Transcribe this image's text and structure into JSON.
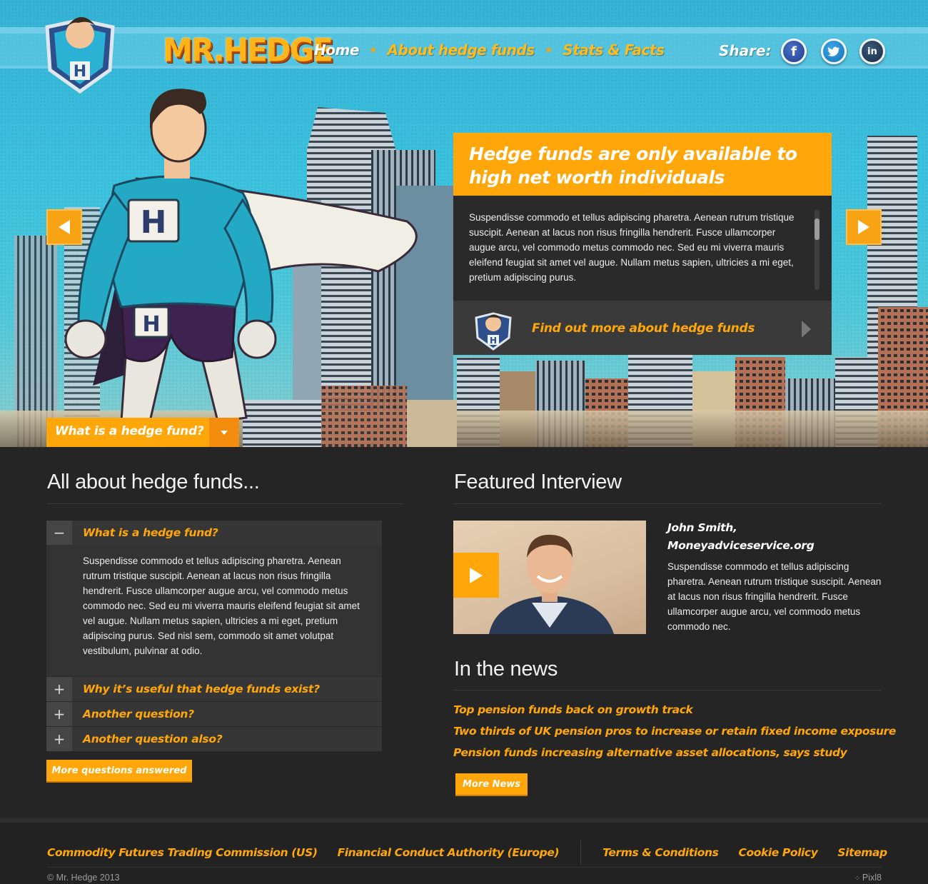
{
  "brand": {
    "name": "MR.HEDGE"
  },
  "nav": {
    "items": [
      {
        "label": "Home"
      },
      {
        "label": "About hedge funds"
      },
      {
        "label": "Stats & Facts"
      }
    ],
    "share_label": "Share:",
    "social": [
      {
        "name": "facebook",
        "glyph": "f",
        "color": "#2f4f9e"
      },
      {
        "name": "twitter",
        "glyph": "t",
        "color": "#1d8fd8"
      },
      {
        "name": "linkedin",
        "glyph": "in",
        "color": "#22344a"
      }
    ]
  },
  "hero": {
    "callout": {
      "title": "Hedge funds are only available to high net worth individuals",
      "body": "Suspendisse commodo et tellus adipiscing pharetra. Aenean rutrum tristique suscipit. Aenean at lacus non risus fringilla hendrerit. Fusce ullamcorper augue arcu, vel commodo metus commodo nec. Sed eu mi viverra mauris eleifend feugiat sit amet vel augue. Nullam metus sapien, ultricies a mi eget, pretium adipiscing purus.",
      "link_label": "Find out more about hedge funds"
    },
    "dropdown_label": "What is a hedge fund?"
  },
  "faq": {
    "title": "All about hedge funds...",
    "items": [
      {
        "question": "What is a hedge fund?",
        "expanded": true,
        "toggle": "−",
        "answer": "Suspendisse commodo et tellus adipiscing pharetra. Aenean rutrum tristique suscipit. Aenean at lacus non risus fringilla hendrerit. Fusce ullamcorper augue arcu, vel commodo metus commodo nec. Sed eu mi viverra mauris eleifend feugiat sit amet vel augue. Nullam metus sapien, ultricies a mi eget, pretium adipiscing purus. Sed nisl sem, commodo sit amet volutpat vestibulum, pulvinar at odio."
      },
      {
        "question": "Why it’s useful that hedge funds exist?",
        "expanded": false,
        "toggle": "+"
      },
      {
        "question": "Another question?",
        "expanded": false,
        "toggle": "+"
      },
      {
        "question": "Another question also?",
        "expanded": false,
        "toggle": "+"
      }
    ],
    "more_button": "More questions answered"
  },
  "interview": {
    "title": "Featured Interview",
    "name_line1": "John Smith,",
    "name_line2": "Moneyadviceservice.org",
    "text": "Suspendisse commodo et tellus adipiscing pharetra. Aenean rutrum tristique suscipit. Aenean at lacus non risus fringilla hendrerit. Fusce ullamcorper augue arcu, vel commodo metus commodo nec."
  },
  "news": {
    "title": "In the news",
    "items": [
      "Top pension funds back on growth track",
      "Two thirds of UK pension pros to increase or retain fixed income exposure",
      "Pension funds increasing alternative asset allocations, says study"
    ],
    "more_button": "More News"
  },
  "footer": {
    "links_left": [
      "Commodity Futures Trading Commission (US)",
      "Financial Conduct Authority (Europe)"
    ],
    "links_right": [
      "Terms & Conditions",
      "Cookie Policy",
      "Sitemap"
    ],
    "copyright": "© Mr. Hedge 2013",
    "credit": "Pixl8"
  },
  "colors": {
    "accent": "#ffa70a",
    "dark_bg": "#252525",
    "sky": "#3cc2df"
  }
}
